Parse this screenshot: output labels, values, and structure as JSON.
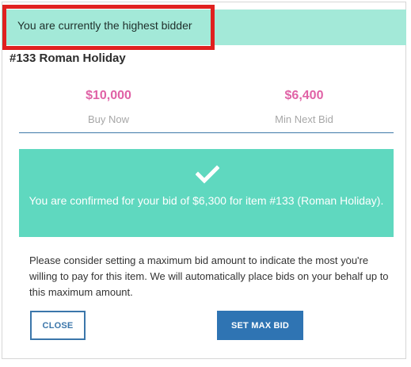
{
  "banner": {
    "text": "You are currently the highest bidder"
  },
  "item": {
    "title": "#133 Roman Holiday"
  },
  "prices": [
    {
      "value": "$10,000",
      "label": "Buy Now"
    },
    {
      "value": "$6,400",
      "label": "Min Next Bid"
    }
  ],
  "confirmation": {
    "icon": "checkmark-icon",
    "text": "You are confirmed for your bid of $6,300 for item #133 (Roman Holiday)."
  },
  "info": {
    "text": "Please consider setting a maximum bid amount to indicate the most you're willing to pay for this item. We will automatically place bids on your behalf up to this maximum amount."
  },
  "buttons": {
    "close_label": "CLOSE",
    "set_max_label": "SET MAX BID"
  },
  "colors": {
    "banner_bg": "#a3e9d8",
    "highlight_border": "#e0201f",
    "price_pink": "#e062a6",
    "confirm_bg": "#5fd8bf",
    "primary_blue": "#2f74b3"
  }
}
